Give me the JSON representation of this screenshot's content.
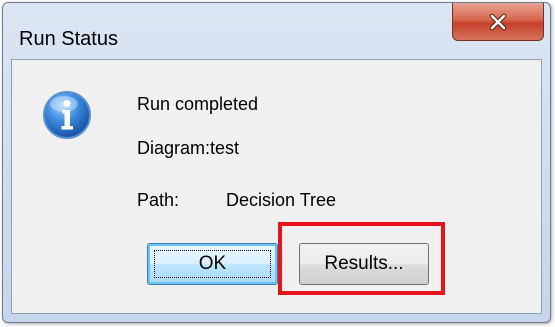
{
  "window": {
    "title": "Run Status"
  },
  "message": {
    "status": "Run completed",
    "diagram_label": "Diagram:",
    "diagram_value": "test",
    "path_label": "Path:",
    "path_value": "Decision Tree"
  },
  "buttons": {
    "ok_label": "OK",
    "results_label": "Results..."
  },
  "icons": {
    "message_icon": "info-icon",
    "close_icon": "close-icon"
  },
  "colors": {
    "highlight": "#e8141b",
    "close_button": "#c5402a",
    "info_icon": "#2f6fc9"
  }
}
